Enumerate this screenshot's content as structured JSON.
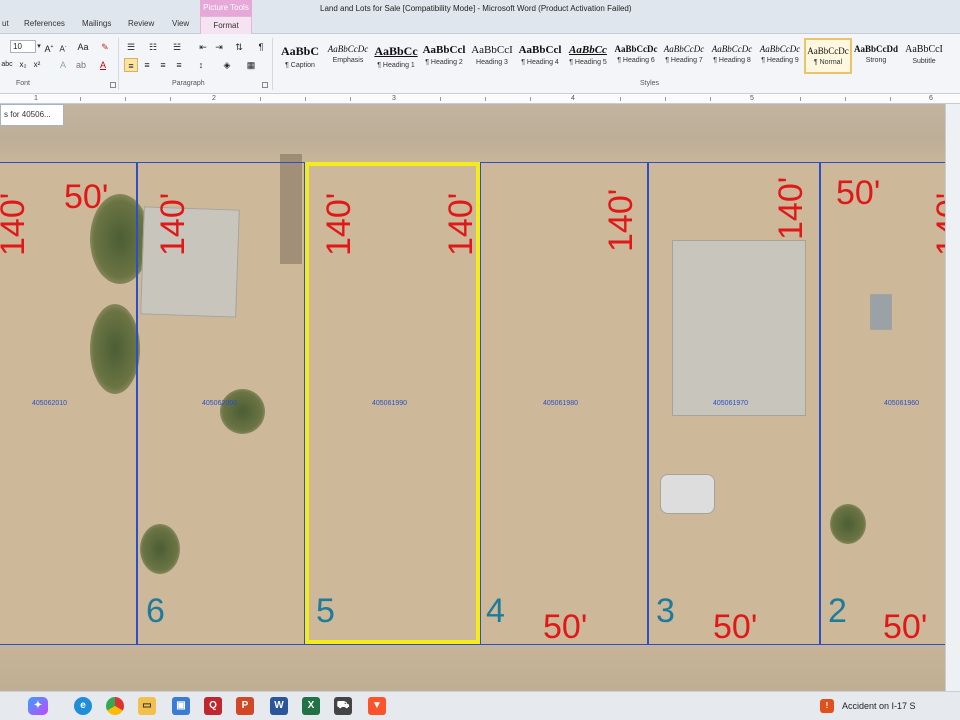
{
  "window": {
    "title": "Land and Lots for Sale [Compatibility Mode] - Microsoft Word (Product Activation Failed)"
  },
  "tabs": [
    "ut",
    "References",
    "Mailings",
    "Review",
    "View"
  ],
  "context_tab": {
    "group": "Picture Tools",
    "label": "Format"
  },
  "ribbon": {
    "font_size": "10",
    "font_group_label": "Font",
    "paragraph_group_label": "Paragraph",
    "styles_group_label": "Styles",
    "styles": [
      {
        "sample": "AaBbC",
        "name": "¶ Caption"
      },
      {
        "sample": "AaBbCcDc",
        "name": "Emphasis"
      },
      {
        "sample": "AaBbCc",
        "name": "¶ Heading 1"
      },
      {
        "sample": "AaBbCcl",
        "name": "¶ Heading 2"
      },
      {
        "sample": "AaBbCcI",
        "name": "Heading 3"
      },
      {
        "sample": "AaBbCcl",
        "name": "¶ Heading 4"
      },
      {
        "sample": "AaBbCc",
        "name": "¶ Heading 5"
      },
      {
        "sample": "AaBbCcDc",
        "name": "¶ Heading 6"
      },
      {
        "sample": "AaBbCcDc",
        "name": "¶ Heading 7"
      },
      {
        "sample": "AaBbCcDc",
        "name": "¶ Heading 8"
      },
      {
        "sample": "AaBbCcDc",
        "name": "¶ Heading 9"
      },
      {
        "sample": "AaBbCcDc",
        "name": "¶ Normal",
        "selected": true
      },
      {
        "sample": "AaBbCcDd",
        "name": "Strong"
      },
      {
        "sample": "AaBbCcI",
        "name": "Subtitle"
      }
    ]
  },
  "ruler": {
    "numbers": [
      "1",
      "2",
      "3",
      "4",
      "5",
      "6"
    ]
  },
  "search_tip": "s for 40506...",
  "map": {
    "lots": [
      {
        "number": "",
        "apn": "405062010"
      },
      {
        "number": "6",
        "apn": "405062000"
      },
      {
        "number": "5",
        "apn": "405061990"
      },
      {
        "number": "4",
        "apn": "405061980"
      },
      {
        "number": "3",
        "apn": "405061970"
      },
      {
        "number": "2",
        "apn": "405061960"
      }
    ],
    "dimensions": {
      "depth": "140'",
      "width": "50'"
    }
  },
  "taskbar": {
    "news": "Accident on I-17 S",
    "apps": [
      "copilot-icon",
      "edge-icon",
      "chrome-icon",
      "file-explorer-icon",
      "remote-icon",
      "quicken-icon",
      "powerpoint-icon",
      "word-icon",
      "excel-icon",
      "car-icon",
      "brave-icon"
    ]
  },
  "colors": {
    "lot_line": "#2a4fc6",
    "dimension_text": "#e01818",
    "lot_number_text": "#1f7b9a",
    "selection": "#f4ec1a"
  }
}
